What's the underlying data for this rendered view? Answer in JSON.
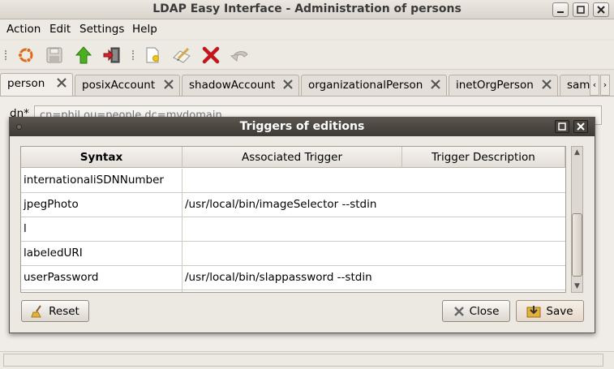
{
  "window": {
    "title": "LDAP Easy Interface - Administration of persons"
  },
  "menu": [
    "Action",
    "Edit",
    "Settings",
    "Help"
  ],
  "toolbar": {
    "icons": [
      "ubuntu-icon",
      "save-icon",
      "upload-arrow-icon",
      "exit-icon",
      "new-document-icon",
      "edit-icon",
      "delete-icon",
      "undo-icon"
    ]
  },
  "tabs": [
    {
      "label": "person",
      "active": true
    },
    {
      "label": "posixAccount"
    },
    {
      "label": "shadowAccount"
    },
    {
      "label": "organizationalPerson"
    },
    {
      "label": "inetOrgPerson"
    },
    {
      "label": "sam"
    }
  ],
  "form": {
    "dn_label": "dn*",
    "dn_placeholder": "cn=phil,ou=people,dc=mydomain"
  },
  "dialog": {
    "title": "Triggers of editions",
    "columns": [
      "Syntax",
      "Associated Trigger",
      "Trigger Description"
    ],
    "rows": [
      {
        "syntax": "internationaliSDNNumber",
        "trigger": ""
      },
      {
        "syntax": "jpegPhoto",
        "trigger": "/usr/local/bin/imageSelector --stdin"
      },
      {
        "syntax": "l",
        "trigger": ""
      },
      {
        "syntax": "labeledURI",
        "trigger": ""
      },
      {
        "syntax": "userPassword",
        "trigger": "/usr/local/bin/slappassword --stdin"
      },
      {
        "syntax": "",
        "trigger": ""
      }
    ],
    "buttons": {
      "reset": "Reset",
      "close": "Close",
      "save": "Save"
    }
  }
}
